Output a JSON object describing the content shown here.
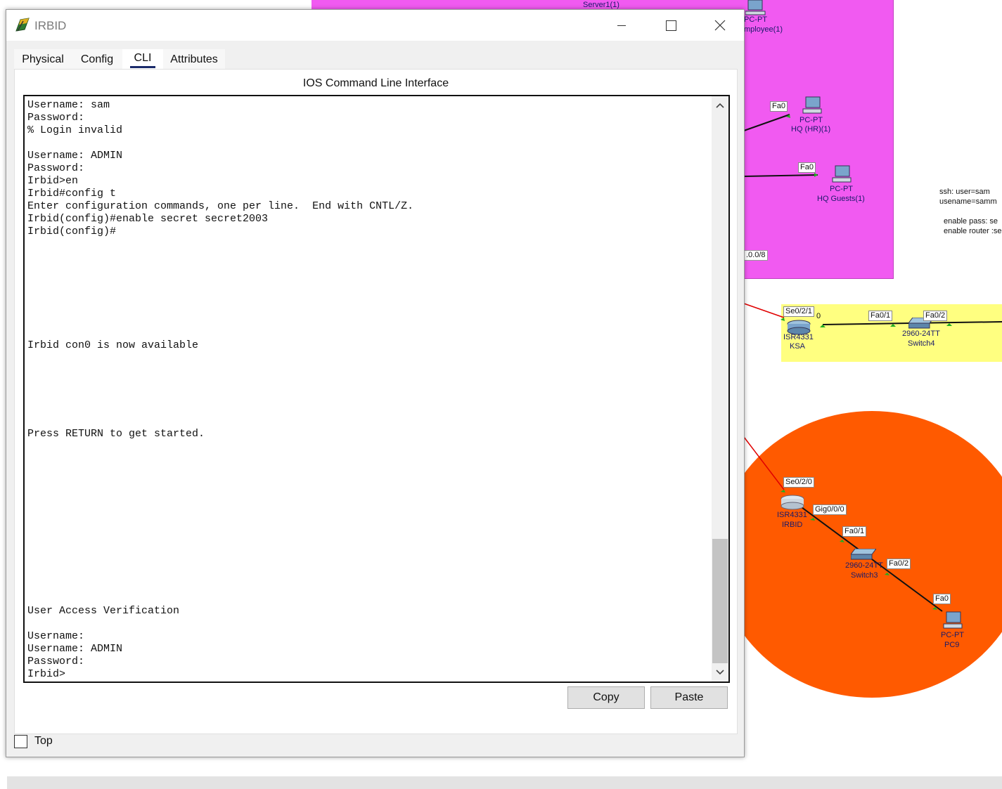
{
  "window": {
    "title": "IRBID",
    "controls": {
      "minimize": "minimize",
      "maximize": "maximize",
      "close": "close"
    }
  },
  "tabs": [
    {
      "label": "Physical",
      "active": false
    },
    {
      "label": "Config",
      "active": false
    },
    {
      "label": "CLI",
      "active": true
    },
    {
      "label": "Attributes",
      "active": false
    }
  ],
  "cli": {
    "heading": "IOS Command Line Interface",
    "console_text": "Username: sam\nPassword:\n% Login invalid\n\nUsername: ADMIN\nPassword:\nIrbid>en\nIrbid#config t\nEnter configuration commands, one per line.  End with CNTL/Z.\nIrbid(config)#enable secret secret2003\nIrbid(config)#\n\n\n\n\n\n\n\n\nIrbid con0 is now available\n\n\n\n\n\n\nPress RETURN to get started.\n\n\n\n\n\n\n\n\n\n\n\n\n\nUser Access Verification\n\nUsername:\nUsername: ADMIN\nPassword:\nIrbid>",
    "copy_label": "Copy",
    "paste_label": "Paste"
  },
  "footer": {
    "top_label": "Top",
    "top_checked": false
  },
  "workspace": {
    "zone_colors": {
      "magenta": "#f15af1",
      "yellow": "#ffff80",
      "orange": "#ff5a00"
    },
    "labels": {
      "server": "Server1(1)",
      "pc_employee_type": "PC-PT",
      "pc_employee_name": "mployee(1)",
      "pc_hr_type": "PC-PT",
      "pc_hr_name": "HQ (HR)(1)",
      "pc_guests_type": "PC-PT",
      "pc_guests_name": "HQ Guests(1)",
      "network": ".0.0/8",
      "ksa_model": "ISR4331",
      "ksa_name": "KSA",
      "switch4_model": "2960-24TT",
      "switch4_name": "Switch4",
      "irbid_model": "ISR4331",
      "irbid_name": "IRBID",
      "switch3_model": "2960-24TT",
      "switch3_name": "Switch3",
      "pc9_type": "PC-PT",
      "pc9_name": "PC9"
    },
    "ports": {
      "hr_fa0": "Fa0",
      "guests_fa0": "Fa0",
      "ksa_se": "Se0/2/1",
      "ksa_gig_partial": "0",
      "sw4_fa01": "Fa0/1",
      "sw4_fa02": "Fa0/2",
      "irbid_se": "Se0/2/0",
      "irbid_gig": "Gig0/0/0",
      "sw3_fa01": "Fa0/1",
      "sw3_fa02": "Fa0/2",
      "pc9_fa0": "Fa0"
    },
    "notes": [
      "ssh: user=sam",
      "usename=samm",
      "",
      "enable pass: se",
      "enable router :se"
    ]
  }
}
